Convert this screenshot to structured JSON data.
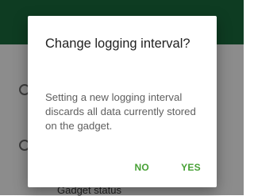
{
  "background": {
    "list_item_label": "Gadget status"
  },
  "dialog": {
    "title": "Change logging interval?",
    "message": "Setting a new logging interval discards all data currently stored on the gadget.",
    "negative_label": "NO",
    "positive_label": "YES"
  },
  "colors": {
    "accent": "#47a135",
    "app_bar": "#1a6e3f"
  }
}
